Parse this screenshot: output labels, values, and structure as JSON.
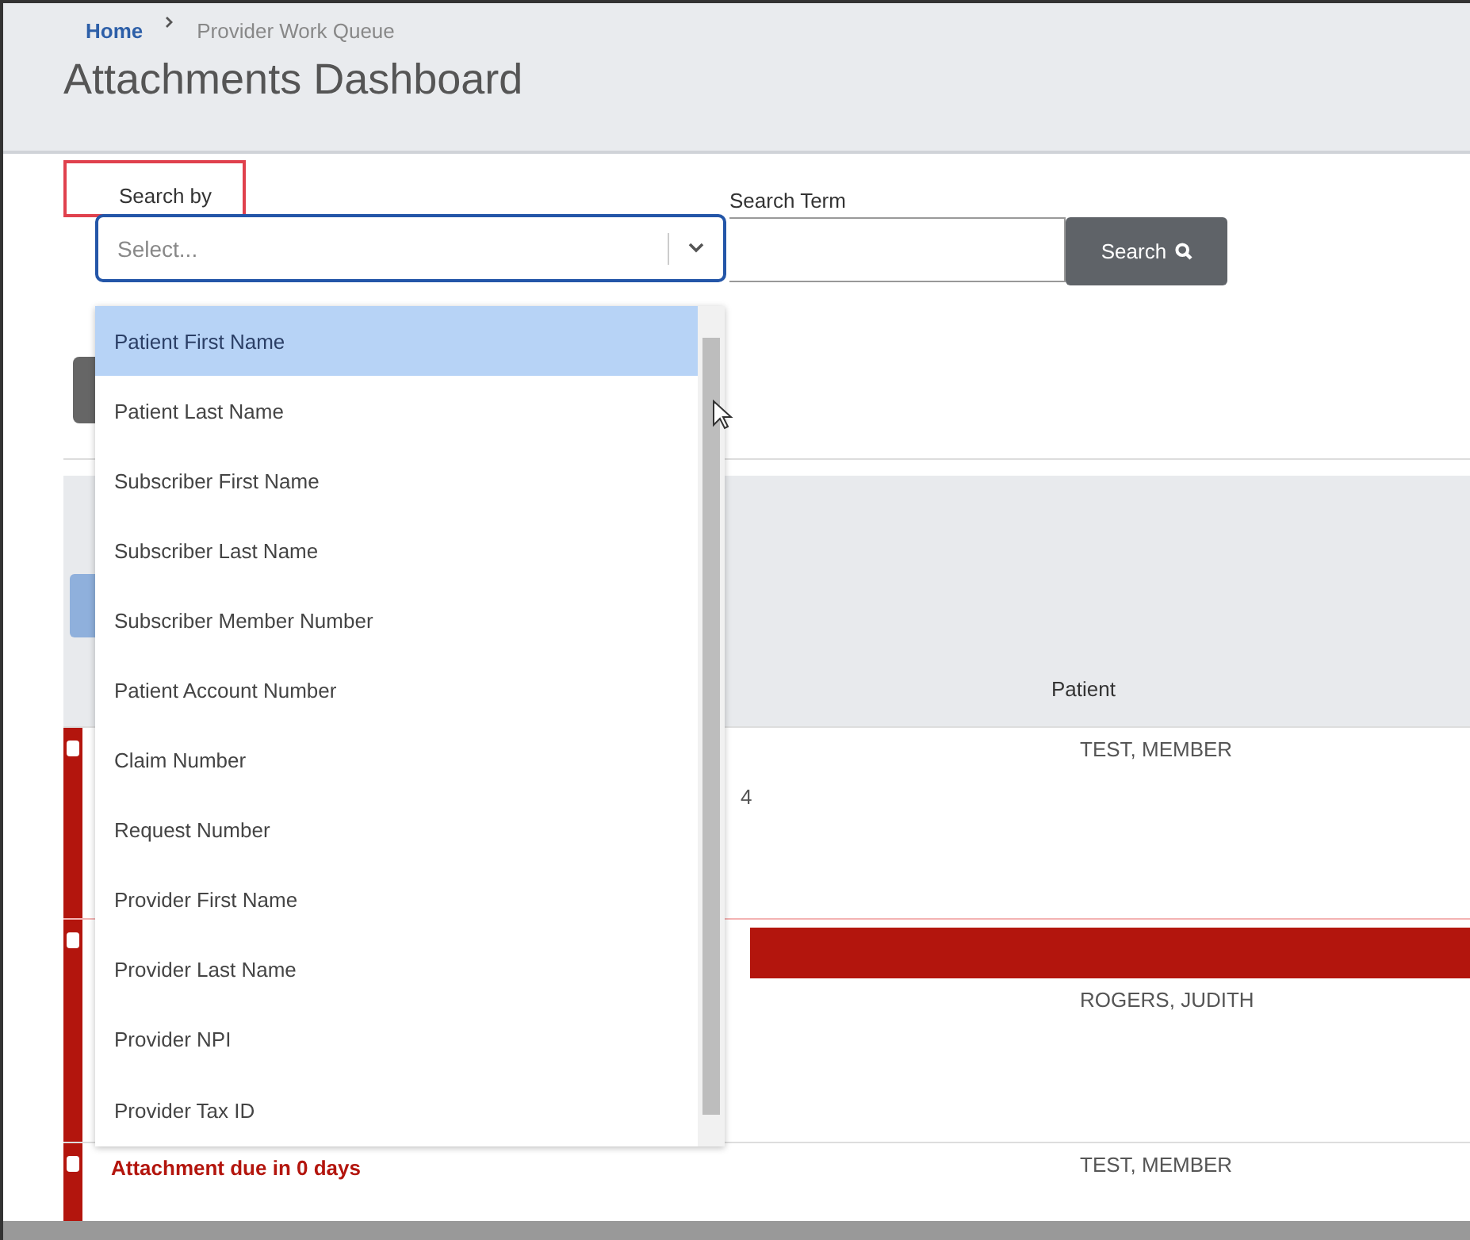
{
  "breadcrumb": [
    {
      "label": "Home",
      "link": true
    },
    {
      "label": "Provider Work Queue",
      "link": false
    }
  ],
  "title": "Attachments Dashboard",
  "search": {
    "search_by_label": "Search by",
    "highlighted": true,
    "select_placeholder": "Select...",
    "term_label": "Search Term",
    "button": "Search"
  },
  "dropdown": {
    "options": [
      {
        "label": "Patient First Name",
        "selected": true
      },
      {
        "label": "Patient Last Name",
        "selected": false
      },
      {
        "label": "Subscriber First Name",
        "selected": false
      },
      {
        "label": "Subscriber Last Name",
        "selected": false
      },
      {
        "label": "Subscriber Member Number",
        "selected": false
      },
      {
        "label": "Patient Account Number",
        "selected": false
      },
      {
        "label": "Claim Number",
        "selected": false
      },
      {
        "label": "Request Number",
        "selected": false
      },
      {
        "label": "Provider First Name",
        "selected": false
      },
      {
        "label": "Provider Last Name",
        "selected": false
      },
      {
        "label": "Provider NPI",
        "selected": false
      },
      {
        "label": "Provider Tax ID",
        "selected": false
      }
    ]
  },
  "table": {
    "columns": [
      "Patient"
    ],
    "rows": [
      {
        "checked": false,
        "column_1": "4",
        "patient": "TEST, MEMBER",
        "banner": false
      },
      {
        "checked": false,
        "patient": "ROGERS, JUDITH",
        "banner": true
      },
      {
        "checked": false,
        "patient": "TEST, MEMBER",
        "banner": false,
        "alert": "Attachment due in 0 days"
      }
    ]
  }
}
